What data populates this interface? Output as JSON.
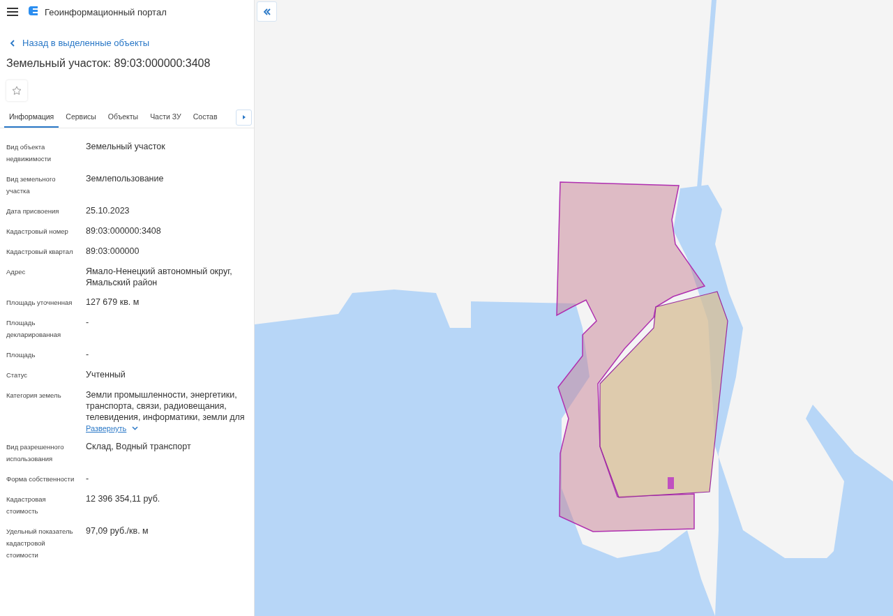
{
  "header": {
    "title": "Геоинформационный портал"
  },
  "back_link": "Назад в выделенные объекты",
  "object_title": "Земельный участок: 89:03:000000:3408",
  "tabs": [
    {
      "label": "Информация",
      "selected": true
    },
    {
      "label": "Сервисы",
      "selected": false
    },
    {
      "label": "Объекты",
      "selected": false
    },
    {
      "label": "Части ЗУ",
      "selected": false
    },
    {
      "label": "Состав",
      "selected": false
    }
  ],
  "fields": [
    {
      "label": "Вид объекта недвижимости",
      "value": "Земельный участок"
    },
    {
      "label": "Вид земельного участка",
      "value": "Землепользование"
    },
    {
      "label": "Дата присвоения",
      "value": "25.10.2023"
    },
    {
      "label": "Кадастровый номер",
      "value": "89:03:000000:3408"
    },
    {
      "label": "Кадастровый квартал",
      "value": "89:03:000000"
    },
    {
      "label": "Адрес",
      "value": "Ямало-Ненецкий автономный округ, Ямальский район"
    },
    {
      "label": "Площадь уточненная",
      "value": "127 679 кв. м"
    },
    {
      "label": "Площадь декларированная",
      "value": "-"
    },
    {
      "label": "Площадь",
      "value": "-"
    },
    {
      "label": "Статус",
      "value": "Учтенный"
    },
    {
      "label": "Категория земель",
      "value": "Земли промышленности, энергетики, транспорта, связи, радиовещания, телевидения, информатики, земли для",
      "expand_link": "Развернуть"
    },
    {
      "label": "Вид разрешенного использования",
      "value": "Склад, Водный транспорт"
    },
    {
      "label": "Форма собственности",
      "value": "-"
    },
    {
      "label": "Кадастровая стоимость",
      "value": "12 396 354,11 руб."
    },
    {
      "label": "Удельный показатель кадастровой стоимости",
      "value": "97,09 руб./кв. м"
    }
  ]
}
